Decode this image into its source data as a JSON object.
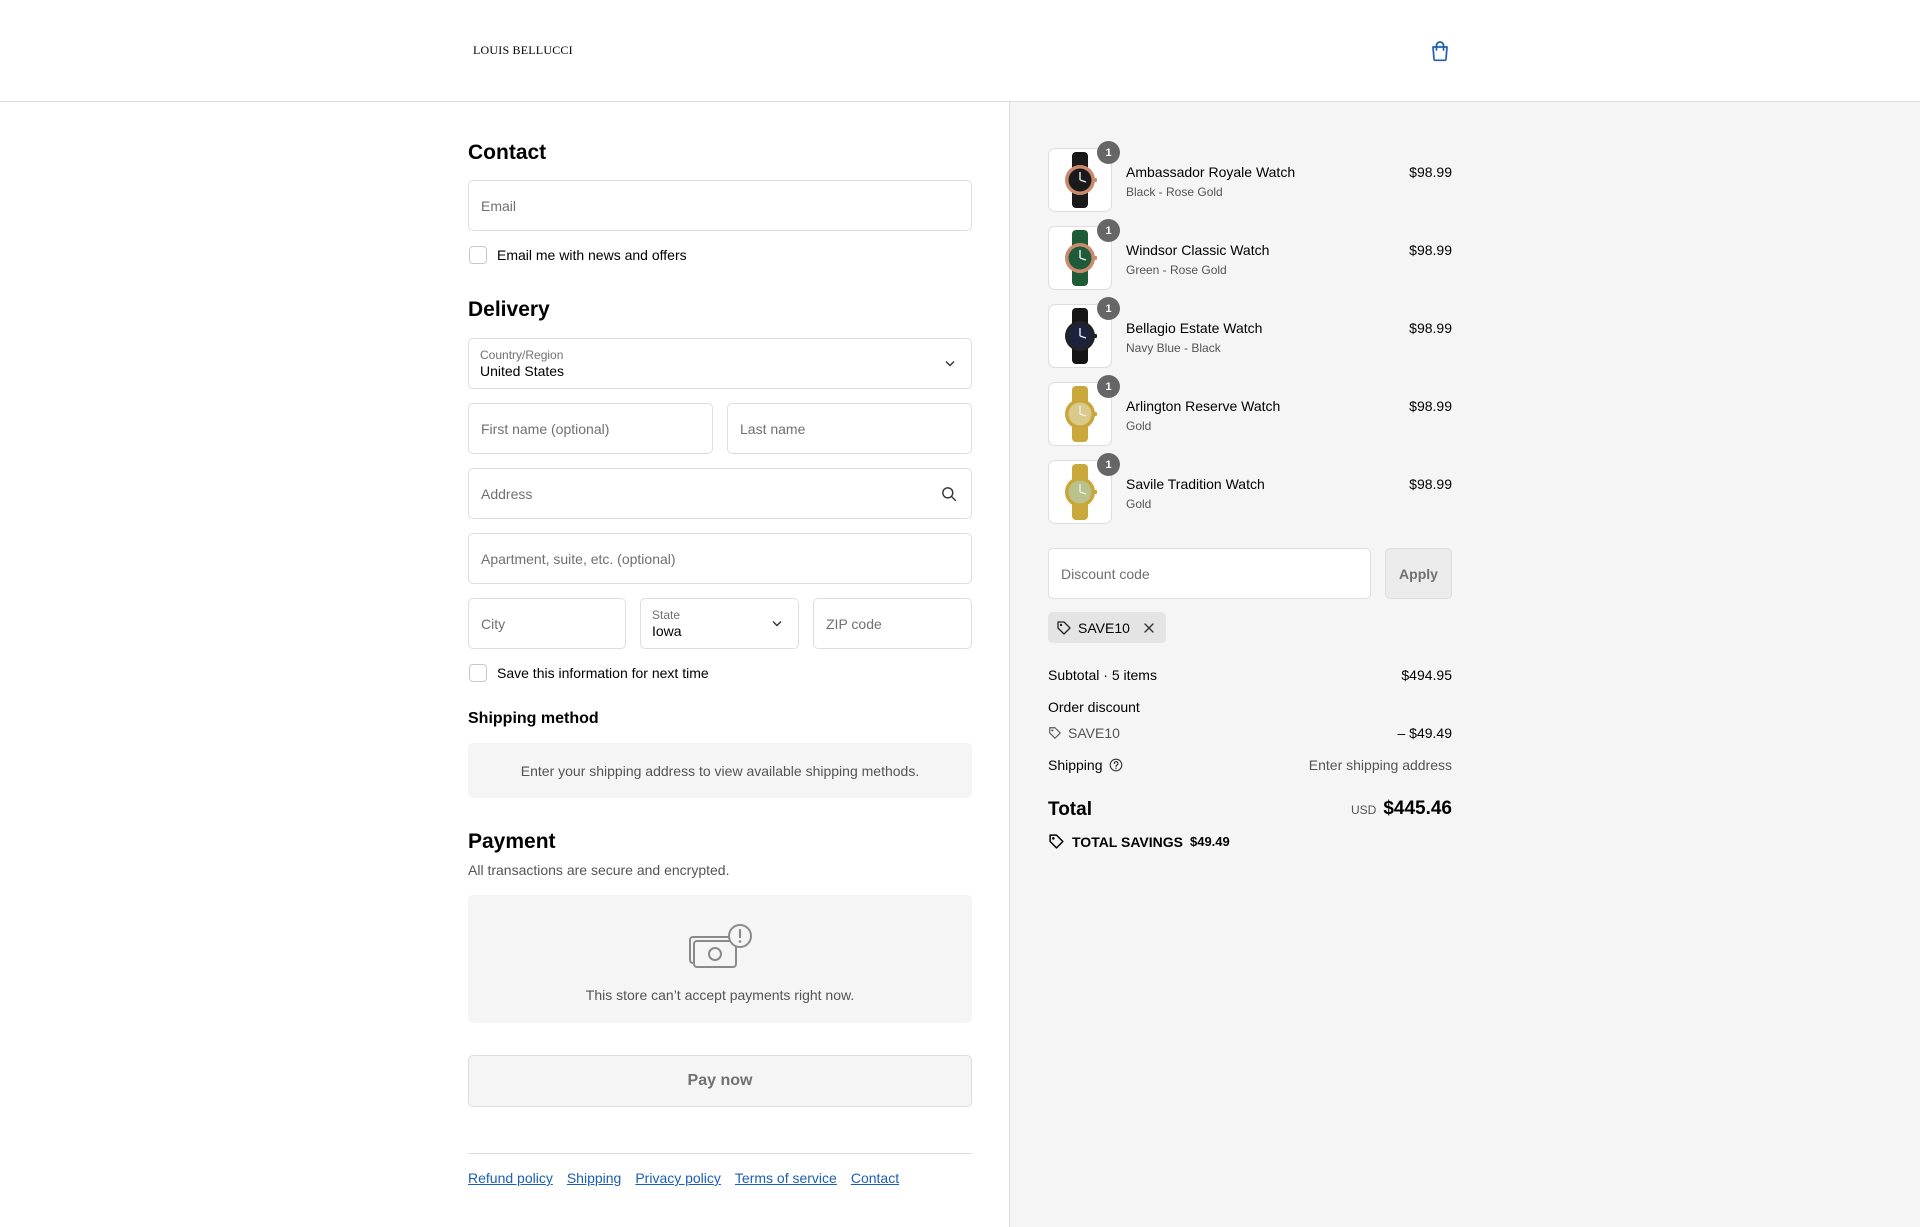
{
  "brand": {
    "logo": "LOUIS BELLUCCI"
  },
  "contact": {
    "heading": "Contact",
    "email_placeholder": "Email",
    "newsletter_label": "Email me with news and offers"
  },
  "delivery": {
    "heading": "Delivery",
    "country_label": "Country/Region",
    "country_value": "United States",
    "first_name_placeholder": "First name (optional)",
    "last_name_placeholder": "Last name",
    "address_placeholder": "Address",
    "apartment_placeholder": "Apartment, suite, etc. (optional)",
    "city_placeholder": "City",
    "state_label": "State",
    "state_value": "Iowa",
    "zip_placeholder": "ZIP code",
    "save_info_label": "Save this information for next time"
  },
  "shipping_method": {
    "heading": "Shipping method",
    "message": "Enter your shipping address to view available shipping methods."
  },
  "payment": {
    "heading": "Payment",
    "subtitle": "All transactions are secure and encrypted.",
    "message": "This store can’t accept payments right now.",
    "pay_button": "Pay now"
  },
  "footer": {
    "links": [
      "Refund policy",
      "Shipping",
      "Privacy policy",
      "Terms of service",
      "Contact"
    ]
  },
  "cart": {
    "items": [
      {
        "name": "Ambassador Royale Watch",
        "variant": "Black - Rose Gold",
        "price": "$98.99",
        "qty": "1",
        "face": "#1a1a1a",
        "strap": "#1a1a1a",
        "case": "#c98b6b"
      },
      {
        "name": "Windsor Classic Watch",
        "variant": "Green - Rose Gold",
        "price": "$98.99",
        "qty": "1",
        "face": "#1f5a3a",
        "strap": "#1d5c36",
        "case": "#c98b6b"
      },
      {
        "name": "Bellagio Estate Watch",
        "variant": "Navy Blue - Black",
        "price": "$98.99",
        "qty": "1",
        "face": "#1b2340",
        "strap": "#151515",
        "case": "#222222"
      },
      {
        "name": "Arlington Reserve Watch",
        "variant": "Gold",
        "price": "$98.99",
        "qty": "1",
        "face": "#d9c98a",
        "strap": "#c9a93c",
        "case": "#caa53a"
      },
      {
        "name": "Savile Tradition Watch",
        "variant": "Gold",
        "price": "$98.99",
        "qty": "1",
        "face": "#b9c28a",
        "strap": "#c9a93c",
        "case": "#caa53a"
      }
    ],
    "discount_placeholder": "Discount code",
    "apply_label": "Apply",
    "applied_code": "SAVE10"
  },
  "summary": {
    "subtotal_label": "Subtotal · 5 items",
    "subtotal_value": "$494.95",
    "order_discount_label": "Order discount",
    "discount_code": "SAVE10",
    "discount_value": "– $49.49",
    "shipping_label": "Shipping",
    "shipping_value": "Enter shipping address",
    "total_label": "Total",
    "currency": "USD",
    "total_value": "$445.46",
    "savings_label": "TOTAL SAVINGS",
    "savings_value": "$49.49"
  },
  "colors": {
    "link": "#1a5fb4",
    "panel": "#f5f5f5",
    "border": "#dedede"
  }
}
